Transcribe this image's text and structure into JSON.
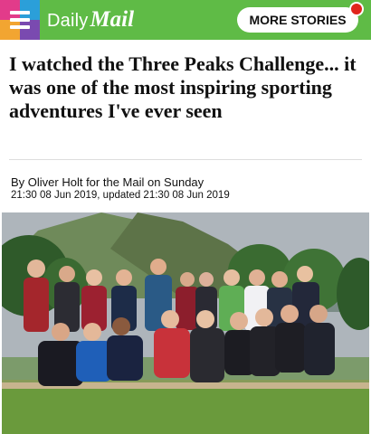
{
  "header": {
    "menu_icon": "hamburger-menu-icon",
    "logo_daily": "Daily",
    "logo_mail": "Mail",
    "more_stories_label": "MORE STORIES",
    "brand_green": "#5fbb46",
    "notification_color": "#e0251c"
  },
  "article": {
    "headline": "I watched the Three Peaks Challenge... it was one of the most inspiring sporting adventures I've ever seen",
    "byline": "By Oliver Holt for the Mail on Sunday",
    "timestamps": "21:30 08 Jun 2019, updated 21:30 08 Jun 2019"
  },
  "photo": {
    "subject": "group-photo"
  }
}
